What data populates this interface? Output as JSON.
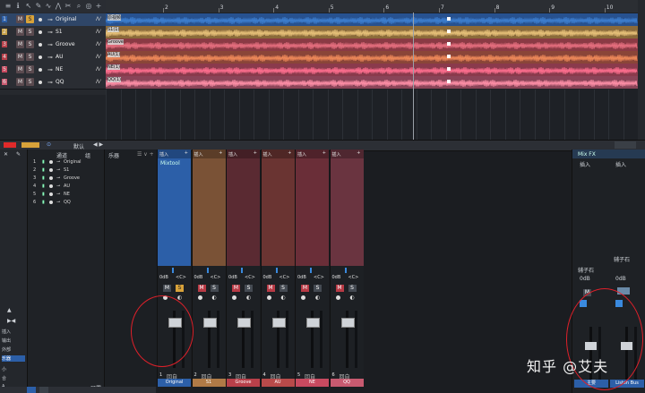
{
  "toolbar": {
    "icons": [
      "add-track-icon",
      "inspector-icon",
      "arrow-tool-icon",
      "draw-tool-icon",
      "erase-tool-icon",
      "bend-tool-icon",
      "split-tool-icon",
      "zoom-tool-icon",
      "listen-tool-icon",
      "add-icon"
    ]
  },
  "ruler": {
    "marks": [
      "2",
      "3",
      "4",
      "5",
      "6",
      "7",
      "8",
      "9",
      "10"
    ]
  },
  "tracks": [
    {
      "num": "1",
      "mute": "M",
      "solo": "S",
      "name": "Original",
      "color": "#2c5fa8",
      "lane_label": "原视频",
      "wave": "#3d7fd0",
      "lane_bg": "#27518f"
    },
    {
      "num": "2",
      "mute": "M",
      "solo": "S",
      "name": "S1",
      "color": "#c8a24a",
      "lane_label": "S1(1)",
      "wave": "#e8c27a",
      "lane_bg": "#8a6a3a"
    },
    {
      "num": "3",
      "mute": "M",
      "solo": "S",
      "name": "Groove",
      "color": "#b8404a",
      "lane_label": "Groove",
      "wave": "#e87080",
      "lane_bg": "#8a3a44"
    },
    {
      "num": "4",
      "mute": "M",
      "solo": "S",
      "name": "AU",
      "color": "#b8404a",
      "lane_label": "AU(1)",
      "wave": "#f08a5a",
      "lane_bg": "#8a4538"
    },
    {
      "num": "5",
      "mute": "M",
      "solo": "S",
      "name": "NE",
      "color": "#c84a60",
      "lane_label": "NE(1)",
      "wave": "#ff7090",
      "lane_bg": "#8a3a4c"
    },
    {
      "num": "6",
      "mute": "M",
      "solo": "S",
      "name": "QQ",
      "color": "#c85a70",
      "lane_label": "QQ(1)",
      "wave": "#ff90a8",
      "lane_bg": "#8a4458"
    }
  ],
  "auto_label": "Λ⁄",
  "mid_bar": {
    "snap_label": "默认",
    "arrow": "◀ ▶"
  },
  "console_side": {
    "items": [
      "插入",
      "输出",
      "外部",
      "乐器"
    ],
    "bottom_tabs": [
      "小",
      "合",
      "A"
    ]
  },
  "channel_panel": {
    "header": "通道",
    "header2": "组",
    "rows": [
      {
        "num": "1",
        "name": "Original"
      },
      {
        "num": "2",
        "name": "S1"
      },
      {
        "num": "3",
        "name": "Groove"
      },
      {
        "num": "4",
        "name": "AU"
      },
      {
        "num": "5",
        "name": "NE"
      },
      {
        "num": "6",
        "name": "QQ"
      }
    ],
    "bottom_label": "预置"
  },
  "instr_panel": {
    "header": "乐器"
  },
  "strips": [
    {
      "insert": "插入",
      "plugin": "Mixtool",
      "gain": "0dB",
      "pan": "<C>",
      "mute": "M",
      "solo": "S",
      "num": "1",
      "name": "Original",
      "body": "#2c5fa8",
      "namebg": "#2c5fa8",
      "auto": "回自"
    },
    {
      "insert": "插入",
      "plugin": "",
      "gain": "0dB",
      "pan": "<C>",
      "mute": "M",
      "solo": "S",
      "num": "2",
      "name": "S1",
      "body": "#7a5236",
      "namebg": "#b07a46",
      "auto": "回自"
    },
    {
      "insert": "插入",
      "plugin": "",
      "gain": "0dB",
      "pan": "<C>",
      "mute": "M",
      "solo": "S",
      "num": "3",
      "name": "Groove",
      "body": "#5a2a32",
      "namebg": "#b8404a",
      "auto": "回自"
    },
    {
      "insert": "插入",
      "plugin": "",
      "gain": "0dB",
      "pan": "<C>",
      "mute": "M",
      "solo": "S",
      "num": "4",
      "name": "AU",
      "body": "#6a3432",
      "namebg": "#b84a4a",
      "auto": "回自"
    },
    {
      "insert": "插入",
      "plugin": "",
      "gain": "0dB",
      "pan": "<C>",
      "mute": "M",
      "solo": "S",
      "num": "5",
      "name": "NE",
      "body": "#6a2e38",
      "namebg": "#c84a60",
      "auto": "回自"
    },
    {
      "insert": "插入",
      "plugin": "",
      "gain": "0dB",
      "pan": "<C>",
      "mute": "M",
      "solo": "S",
      "num": "6",
      "name": "QQ",
      "body": "#6a3440",
      "namebg": "#c85a70",
      "auto": "回自"
    }
  ],
  "mixfx": {
    "header": "Mix FX",
    "insert1": "插入",
    "insert2": "插入",
    "send1": "辅子石",
    "send2": "辅子石",
    "bus1": "主要",
    "bus2": "Listen Bus",
    "gain1": "0dB",
    "gain2": "0dB"
  },
  "watermark": "知乎 @艾夫"
}
